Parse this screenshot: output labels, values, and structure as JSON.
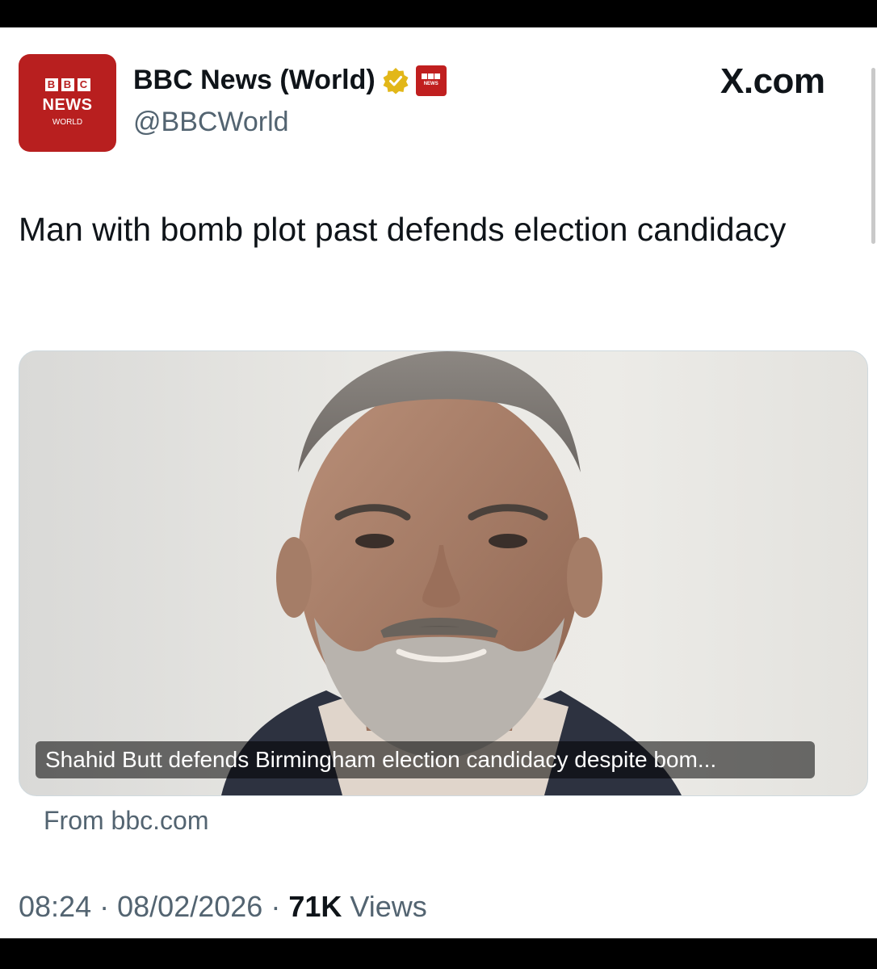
{
  "author": {
    "display_name": "BBC News (World)",
    "handle": "@BBCWorld",
    "avatar": {
      "blocks": [
        "B",
        "B",
        "C"
      ],
      "line1": "NEWS",
      "line2": "WORLD"
    },
    "verified_icon": "gold-verified-badge-icon",
    "affiliate_badge": {
      "line": "NEWS"
    }
  },
  "site_label": "X.com",
  "post": {
    "headline": "Man with bomb plot past defends election candidacy"
  },
  "link_card": {
    "image_description_icon": "portrait-photo",
    "caption": "Shahid Butt defends Birmingham election candidacy despite bom...",
    "source": "From bbc.com"
  },
  "meta": {
    "time": "08:24",
    "separator": "·",
    "date": "08/02/2026",
    "views_count": "71K",
    "views_label": "Views"
  },
  "colors": {
    "brand_red": "#b81f1f",
    "text_primary": "#0f1419",
    "text_secondary": "#536471",
    "verified_gold": "#e2b719"
  }
}
